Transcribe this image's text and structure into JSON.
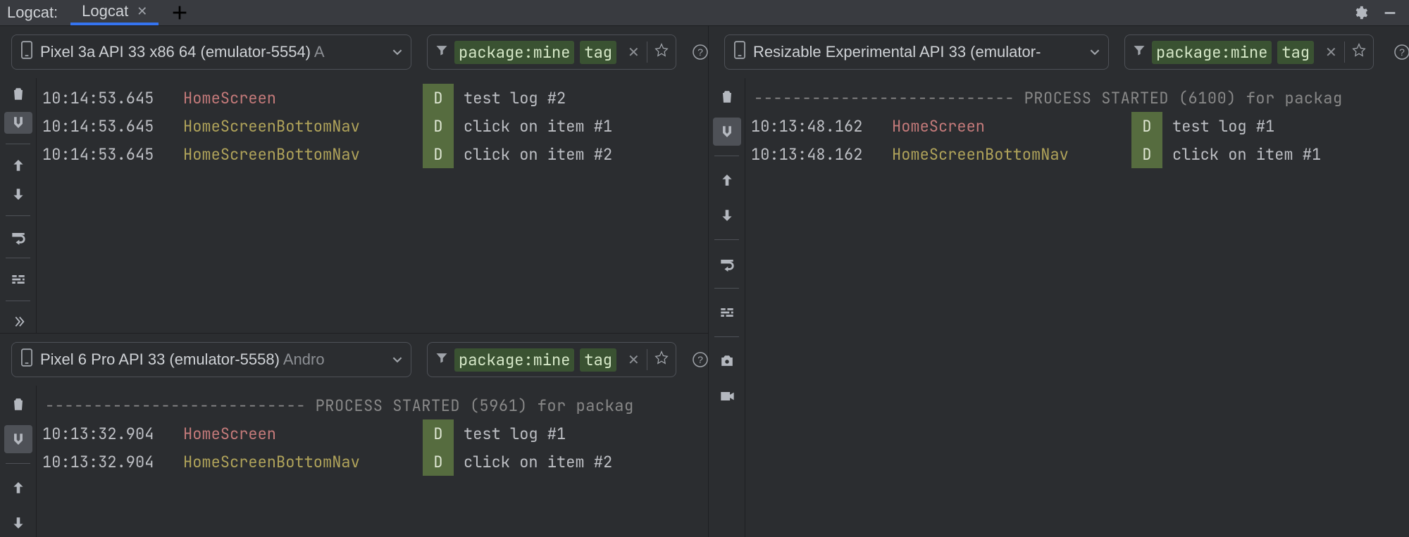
{
  "header": {
    "title": "Logcat:",
    "tabs": [
      {
        "label": "Logcat",
        "active": true
      }
    ]
  },
  "filter": {
    "tokens": [
      "package:mine",
      "tag"
    ]
  },
  "panes": {
    "top_left": {
      "device": {
        "label": "Pixel 3a API 33 x86 64 (emulator-5554)",
        "extra": " A"
      },
      "lines": [
        {
          "ts": "10:14:53.645",
          "src": "HomeScreen",
          "srcClass": "src-home",
          "lvl": "D",
          "msg": "test log #2"
        },
        {
          "ts": "10:14:53.645",
          "src": "HomeScreenBottomNav",
          "srcClass": "src-nav",
          "lvl": "D",
          "msg": "click on item #1"
        },
        {
          "ts": "10:14:53.645",
          "src": "HomeScreenBottomNav",
          "srcClass": "src-nav",
          "lvl": "D",
          "msg": "click on item #2"
        }
      ]
    },
    "bottom_left": {
      "device": {
        "label": "Pixel 6 Pro API 33 (emulator-5558)",
        "extra": " Andro"
      },
      "proc_line": "--------------------------- PROCESS STARTED (5961) for packag",
      "lines": [
        {
          "ts": "10:13:32.904",
          "src": "HomeScreen",
          "srcClass": "src-home",
          "lvl": "D",
          "msg": "test log #1"
        },
        {
          "ts": "10:13:32.904",
          "src": "HomeScreenBottomNav",
          "srcClass": "src-nav",
          "lvl": "D",
          "msg": "click on item #2"
        }
      ]
    },
    "right": {
      "device": {
        "label": "Resizable Experimental API 33 (emulator-",
        "extra": ""
      },
      "proc_line": "--------------------------- PROCESS STARTED (6100) for packag",
      "lines": [
        {
          "ts": "10:13:48.162",
          "src": "HomeScreen",
          "srcClass": "src-home",
          "lvl": "D",
          "msg": "test log #1"
        },
        {
          "ts": "10:13:48.162",
          "src": "HomeScreenBottomNav",
          "srcClass": "src-nav",
          "lvl": "D",
          "msg": "click on item #1"
        }
      ]
    }
  }
}
